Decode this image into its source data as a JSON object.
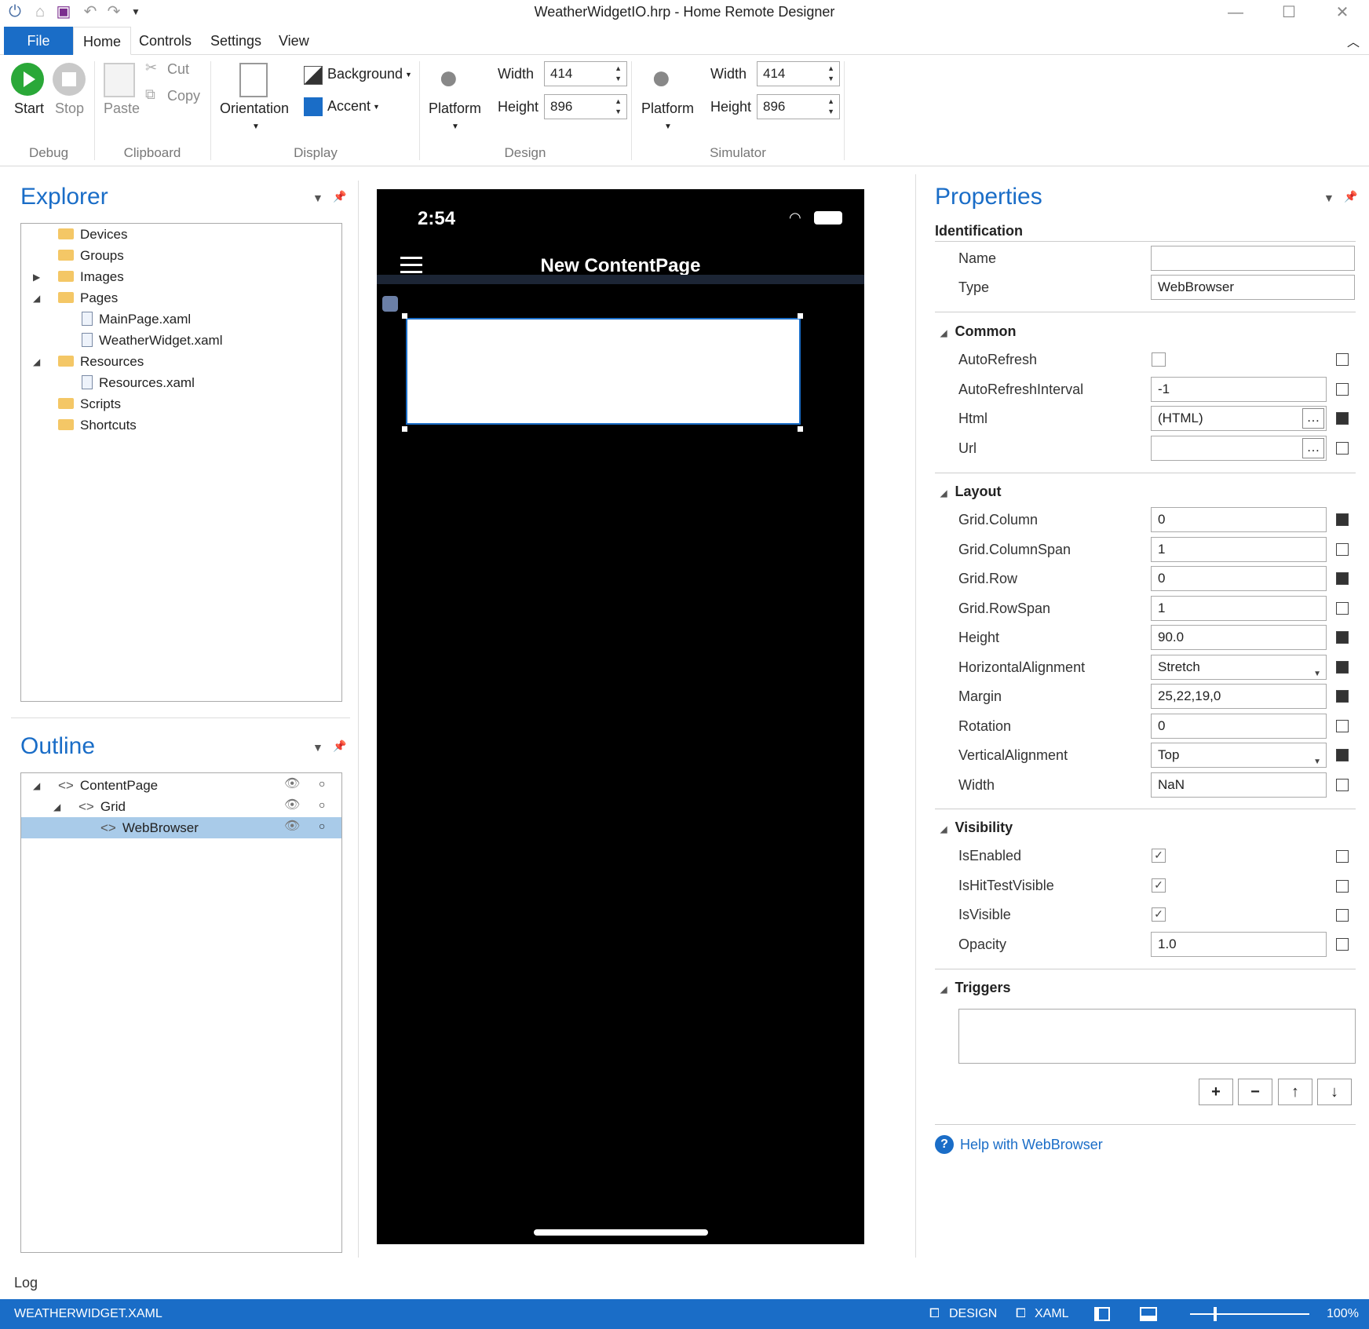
{
  "window": {
    "title": "WeatherWidgetIO.hrp - Home Remote Designer"
  },
  "ribbon_tabs": [
    "File",
    "Home",
    "Controls",
    "Settings",
    "View"
  ],
  "ribbon": {
    "debug": {
      "start": "Start",
      "stop": "Stop",
      "group": "Debug"
    },
    "clipboard": {
      "paste": "Paste",
      "cut": "Cut",
      "copy": "Copy",
      "group": "Clipboard"
    },
    "display": {
      "orientation": "Orientation",
      "background": "Background",
      "accent": "Accent",
      "group": "Display",
      "accent_color": "#1a6dc7"
    },
    "design": {
      "platform": "Platform",
      "width_label": "Width",
      "width_value": "414",
      "height_label": "Height",
      "height_value": "896",
      "group": "Design"
    },
    "simulator": {
      "platform": "Platform",
      "width_label": "Width",
      "width_value": "414",
      "height_label": "Height",
      "height_value": "896",
      "group": "Simulator"
    }
  },
  "explorer": {
    "title": "Explorer",
    "items": [
      "Devices",
      "Groups",
      "Images",
      "Pages",
      "MainPage.xaml",
      "WeatherWidget.xaml",
      "Resources",
      "Resources.xaml",
      "Scripts",
      "Shortcuts"
    ]
  },
  "outline": {
    "title": "Outline",
    "items": [
      "ContentPage",
      "Grid",
      "WebBrowser"
    ]
  },
  "phone": {
    "time": "2:54",
    "page_title": "New ContentPage"
  },
  "properties": {
    "title": "Properties",
    "identification": "Identification",
    "name_label": "Name",
    "name_value": "",
    "type_label": "Type",
    "type_value": "WebBrowser",
    "common": "Common",
    "common_rows": [
      {
        "label": "AutoRefresh",
        "value": ""
      },
      {
        "label": "AutoRefreshInterval",
        "value": "-1"
      },
      {
        "label": "Html",
        "value": "(HTML)"
      },
      {
        "label": "Url",
        "value": ""
      }
    ],
    "layout": "Layout",
    "layout_rows": [
      {
        "label": "Grid.Column",
        "value": "0"
      },
      {
        "label": "Grid.ColumnSpan",
        "value": "1"
      },
      {
        "label": "Grid.Row",
        "value": "0"
      },
      {
        "label": "Grid.RowSpan",
        "value": "1"
      },
      {
        "label": "Height",
        "value": "90.0"
      },
      {
        "label": "HorizontalAlignment",
        "value": "Stretch"
      },
      {
        "label": "Margin",
        "value": "25,22,19,0"
      },
      {
        "label": "Rotation",
        "value": "0"
      },
      {
        "label": "VerticalAlignment",
        "value": "Top"
      },
      {
        "label": "Width",
        "value": "NaN"
      }
    ],
    "visibility": "Visibility",
    "visibility_rows": [
      {
        "label": "IsEnabled",
        "value": ""
      },
      {
        "label": "IsHitTestVisible",
        "value": ""
      },
      {
        "label": "IsVisible",
        "value": ""
      },
      {
        "label": "Opacity",
        "value": "1.0"
      }
    ],
    "triggers": "Triggers",
    "help": "Help with WebBrowser"
  },
  "log_label": "Log",
  "statusbar": {
    "file": "WEATHERWIDGET.XAML",
    "design": "DESIGN",
    "xaml": "XAML",
    "zoom": "100%"
  }
}
